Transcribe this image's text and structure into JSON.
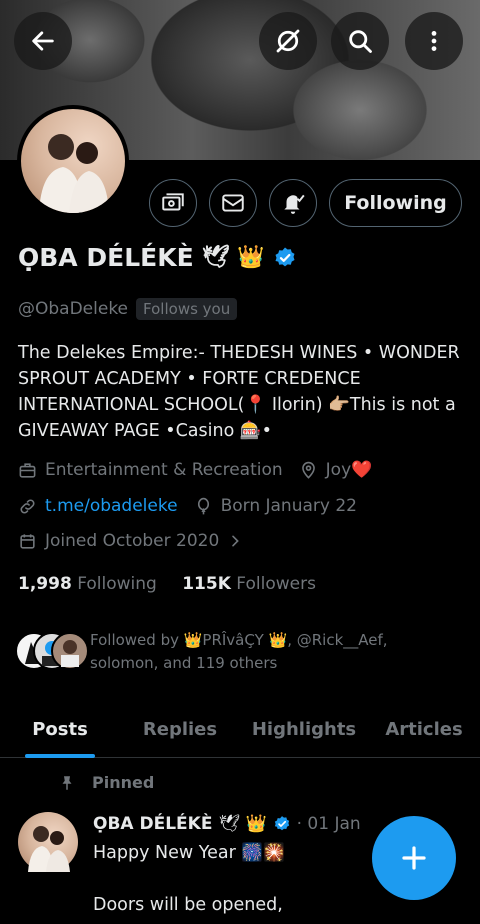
{
  "header": {
    "back_icon": "arrow-left-icon",
    "grok_icon": "slash-circle-icon",
    "search_icon": "search-icon",
    "more_icon": "more-vertical-icon"
  },
  "profile": {
    "name": "ỌBA DÉLÉKÈ",
    "name_emojis": "🕊 👑",
    "handle": "@ObaDeleke",
    "follows_you": "Follows you",
    "following_button": "Following",
    "bio": "The Delekes Empire:- THEDESH WINES • WONDER SPROUT ACADEMY • FORTE CREDENCE INTERNATIONAL SCHOOL(📍 Ilorin) 👉🏼This is not a GIVEAWAY PAGE •Casino 🎰•",
    "category": "Entertainment & Recreation",
    "location": "Joy❤️",
    "website": "t.me/obadeleke",
    "birthday": "Born January 22",
    "joined": "Joined October 2020",
    "following_count": "1,998",
    "following_label": "Following",
    "followers_count": "115K",
    "followers_label": "Followers",
    "followed_by": "Followed by 👑PRÎvâÇY 👑, @Rick__Aef, solomon, and 119 others"
  },
  "tabs": [
    {
      "label": "Posts",
      "active": true
    },
    {
      "label": "Replies",
      "active": false
    },
    {
      "label": "Highlights",
      "active": false
    },
    {
      "label": "Articles",
      "active": false
    }
  ],
  "tweet": {
    "pinned_label": "Pinned",
    "author": "ỌBA DÉLÉKÈ",
    "author_emojis": "🕊 👑",
    "date": "· 01 Jan",
    "line1": "Happy New Year 🎆🎇",
    "line2": "Doors will be opened,"
  },
  "colors": {
    "accent": "#1d9bf0",
    "muted": "#71767b",
    "text": "#e7e9ea",
    "background": "#000000"
  }
}
